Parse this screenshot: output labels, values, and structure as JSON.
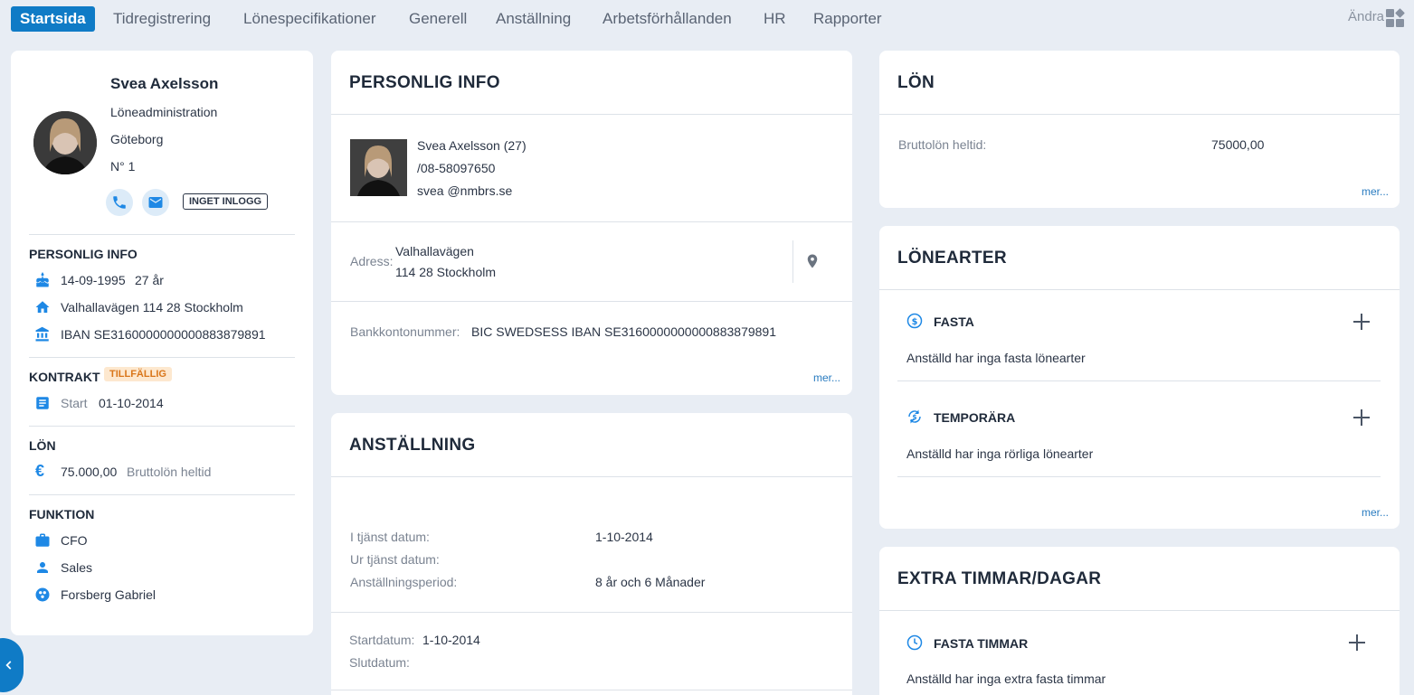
{
  "nav": {
    "tabs": [
      "Startsida",
      "Tidregistrering",
      "Lönespecifikationer",
      "Generell",
      "Anställning",
      "Arbetsförhållanden",
      "HR",
      "Rapporter"
    ],
    "edit_label": "Ändra"
  },
  "profile": {
    "name": "Svea Axelsson",
    "department": "Löneadministration",
    "city": "Göteborg",
    "number": "N° 1",
    "login_badge": "INGET INLOGG",
    "personal_heading": "PERSONLIG INFO",
    "birthdate": "14-09-1995",
    "age": "27 år",
    "address": "Valhallavägen 114 28 Stockholm",
    "iban": "IBAN SE3160000000000883879891",
    "contract_heading": "KONTRAKT",
    "contract_badge": "TILLFÄLLIG",
    "start_label": "Start",
    "start_date": "01-10-2014",
    "salary_heading": "LÖN",
    "salary_value": "75.000,00",
    "salary_label": "Bruttolön heltid",
    "function_heading": "FUNKTION",
    "function_title": "CFO",
    "function_unit": "Sales",
    "function_manager": "Forsberg Gabriel"
  },
  "personal_info": {
    "heading": "PERSONLIG INFO",
    "name_age": "Svea Axelsson (27)",
    "phone": "/08-58097650",
    "email": "svea @nmbrs.se",
    "address_label": "Adress:",
    "address_line1": "Valhallavägen",
    "address_line2": "114 28 Stockholm",
    "bank_label": "Bankkontonummer:",
    "bank_value": "BIC SWEDSESS IBAN SE3160000000000883879891",
    "more": "mer..."
  },
  "employment": {
    "heading": "ANSTÄLLNING",
    "in_service_label": "I tjänst datum:",
    "in_service_value": "1-10-2014",
    "out_service_label": "Ur tjänst datum:",
    "period_label": "Anställningsperiod:",
    "period_value": "8 år och 6 Månader",
    "start_label": "Startdatum:",
    "start_value": "1-10-2014",
    "end_label": "Slutdatum:"
  },
  "salary": {
    "heading": "LÖN",
    "gross_label": "Bruttolön heltid:",
    "gross_value": "75000,00",
    "more": "mer..."
  },
  "wage_types": {
    "heading": "LÖNEARTER",
    "fixed_label": "FASTA",
    "fixed_empty": "Anställd har inga fasta lönearter",
    "temp_label": "TEMPORÄRA",
    "temp_empty": "Anställd har inga rörliga lönearter",
    "more": "mer..."
  },
  "extra_hours": {
    "heading": "EXTRA TIMMAR/DAGAR",
    "fixed_hours_label": "FASTA TIMMAR",
    "fixed_hours_empty": "Anställd har inga extra fasta timmar"
  },
  "colors": {
    "accent": "#0f7bc6",
    "icon_blue": "#1e88e5",
    "badge_orange_bg": "#fde8cf",
    "badge_orange_text": "#d9761a",
    "background": "#e8edf4"
  }
}
